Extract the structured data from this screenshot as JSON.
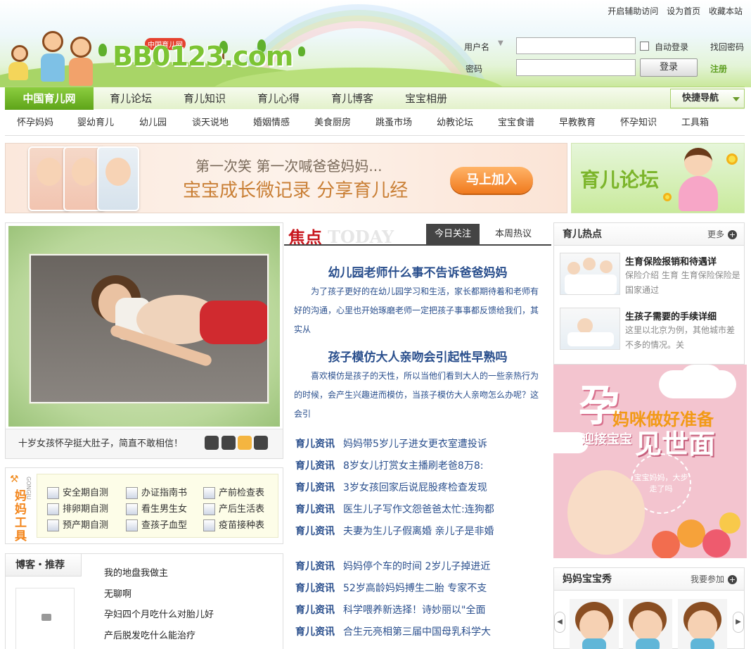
{
  "header": {
    "logo_text": "BB0123.com",
    "logo_sub": "中国育儿网",
    "top_links": [
      "开启辅助访问",
      "设为首页",
      "收藏本站"
    ]
  },
  "login": {
    "username_label": "用户名",
    "password_label": "密码",
    "auto_login": "自动登录",
    "forgot": "找回密码",
    "login_button": "登录",
    "register": "注册"
  },
  "mainnav": {
    "active": "中国育儿网",
    "items": [
      "育儿论坛",
      "育儿知识",
      "育儿心得",
      "育儿博客",
      "宝宝相册"
    ],
    "quick": "快捷导航"
  },
  "subnav": [
    "怀孕妈妈",
    "婴幼育儿",
    "幼儿园",
    "谈天说地",
    "婚姻情感",
    "美食厨房",
    "跳蚤市场",
    "幼教论坛",
    "宝宝食谱",
    "早教教育",
    "怀孕知识",
    "工具箱"
  ],
  "banner": {
    "line1": "第一次笑  第一次喊爸爸妈妈...",
    "line2": "宝宝成长微记录  分享育儿经",
    "button": "马上加入",
    "right_text": "育儿论坛"
  },
  "slider": {
    "caption": "十岁女孩怀孕挺大肚子，简直不敢相信！"
  },
  "tools": {
    "title": "妈妈工具",
    "en": "GONGJU",
    "items": [
      "安全期自测",
      "办证指南书",
      "产前检查表",
      "排卵期自测",
      "看生男生女",
      "产后生活表",
      "预产期自测",
      "查孩子血型",
      "疫苗接种表"
    ]
  },
  "blog": {
    "title": "博客・推荐",
    "items": [
      "我的地盘我做主",
      "无聊啊",
      "孕妇四个月吃什么对胎儿好",
      "产后脱发吃什么能治疗"
    ]
  },
  "focus": {
    "cn": "焦点",
    "en": "TODAY",
    "tab_active": "今日关注",
    "tab_other": "本周热议",
    "h1": "幼儿园老师什么事不告诉爸爸妈妈",
    "p1": "为了孩子更好的在幼儿园学习和生活，家长都期待着和老师有好的沟通，心里也开始琢磨老师一定把孩子事事都反馈给我们，其实从",
    "h2": "孩子模仿大人亲吻会引起性早熟吗",
    "p2": "喜欢模仿是孩子的天性，所以当他们看到大人的一些亲热行为的时候，会产生兴趣进而模仿，当孩子模仿大人亲吻怎么办呢？这会引"
  },
  "news": {
    "tag": "育儿资讯",
    "group1": [
      "妈妈带5岁儿子进女更衣室遭投诉",
      "8岁女儿打赏女主播刷老爸8万8:",
      "3岁女孩回家后说屁股疼检查发现",
      "医生儿子写作文怨爸爸太忙:连狗都",
      "夫妻为生儿子假离婚 亲儿子是非婚"
    ],
    "group2": [
      "妈妈停个车的时间 2岁儿子掉进近",
      "52岁高龄妈妈搏生二胎 专家不支",
      "科学喂养新选择！诗妙丽以\"全面",
      "合生元亮相第三届中国母乳科学大"
    ]
  },
  "hot": {
    "title": "育儿热点",
    "more": "更多",
    "items": [
      {
        "title": "生育保险报销和待遇详",
        "desc": "保险介绍      生育 生育保险保险是国家通过"
      },
      {
        "title": "生孩子需要的手续详细",
        "desc": "这里以北京为例，其他城市差不多的情况。关"
      }
    ]
  },
  "ad": {
    "big": "孕",
    "l1": "妈咪做好准备",
    "l2": "迎接宝宝",
    "l3": "见世面",
    "circle": "宝宝妈妈，大步走了吗"
  },
  "show": {
    "title": "妈妈宝宝秀",
    "join": "我要参加"
  },
  "colors": {
    "green_accent": "#6aae23",
    "link_blue": "#2a4f8d",
    "focus_red": "#c8161d",
    "ad_pink": "#f3c4cf"
  }
}
